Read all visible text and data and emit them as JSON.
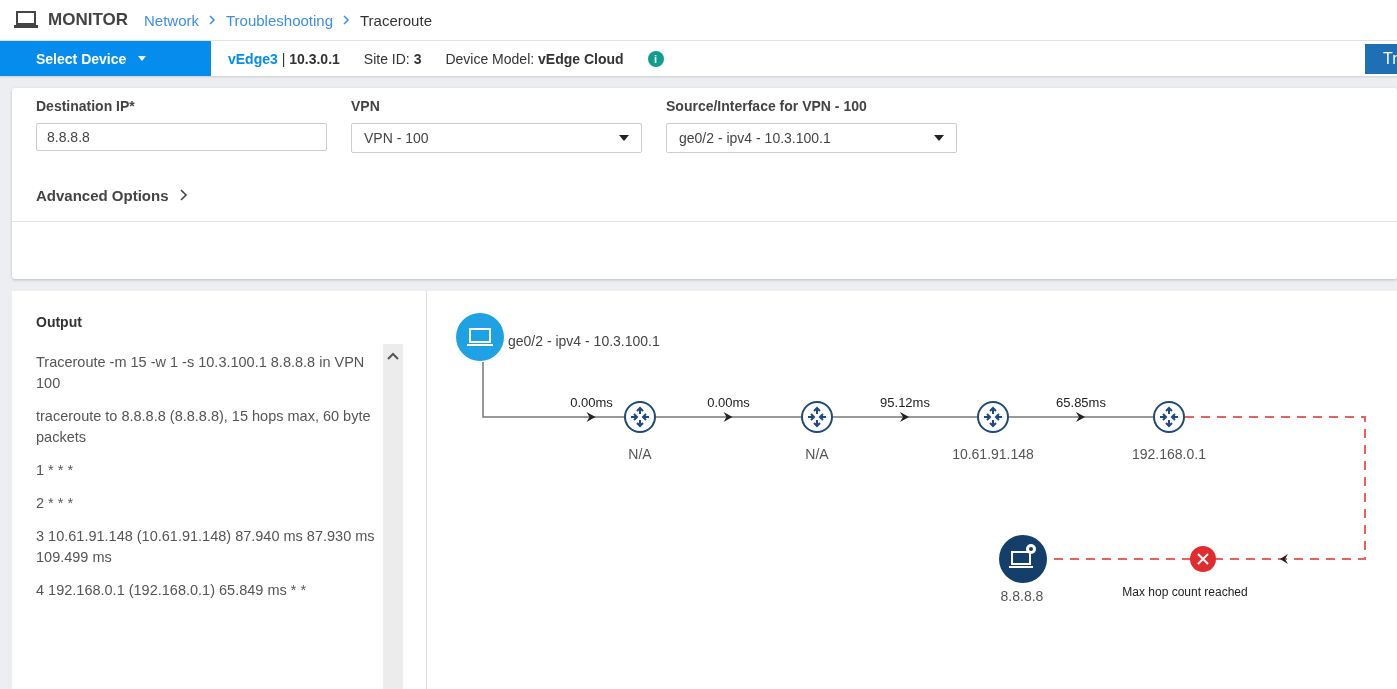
{
  "header": {
    "title": "MONITOR",
    "breadcrumbs": [
      {
        "label": "Network",
        "link": true
      },
      {
        "label": "Troubleshooting",
        "link": true
      },
      {
        "label": "Traceroute",
        "link": false
      }
    ]
  },
  "device_bar": {
    "select_label": "Select Device",
    "device_name": "vEdge3",
    "separator": "|",
    "device_ip": "10.3.0.1",
    "site_label": "Site ID:",
    "site_id": "3",
    "model_label": "Device Model:",
    "model": "vEdge Cloud",
    "info": "i",
    "action_button": "Tr"
  },
  "form": {
    "fields": [
      {
        "kind": "input",
        "label": "Destination IP*",
        "value": "8.8.8.8"
      },
      {
        "kind": "select",
        "label": "VPN",
        "value": "VPN - 100"
      },
      {
        "kind": "select",
        "label": "Source/Interface for VPN - 100",
        "value": "ge0/2 - ipv4 - 10.3.100.1"
      }
    ],
    "advanced_options": {
      "label": "Advanced Options",
      "expanded": false
    }
  },
  "output": {
    "title": "Output",
    "lines": [
      "Traceroute -m 15 -w 1 -s 10.3.100.1 8.8.8.8 in VPN 100",
      "traceroute to 8.8.8.8 (8.8.8.8), 15 hops max, 60 byte packets",
      "1 * * *",
      "2 * * *",
      "3 10.61.91.148 (10.61.91.148) 87.940 ms 87.930 ms 109.499 ms",
      "4 192.168.0.1 (192.168.0.1) 65.849 ms * *"
    ]
  },
  "diagram": {
    "source": "ge0/2 - ipv4 - 10.3.100.1",
    "hops": [
      {
        "label": "N/A",
        "latency": "0.00ms"
      },
      {
        "label": "N/A",
        "latency": "0.00ms"
      },
      {
        "label": "10.61.91.148",
        "latency": "95.12ms"
      },
      {
        "label": "192.168.0.1",
        "latency": "65.85ms"
      }
    ],
    "failure": "Max hop count reached",
    "destination": "8.8.8.8"
  }
}
